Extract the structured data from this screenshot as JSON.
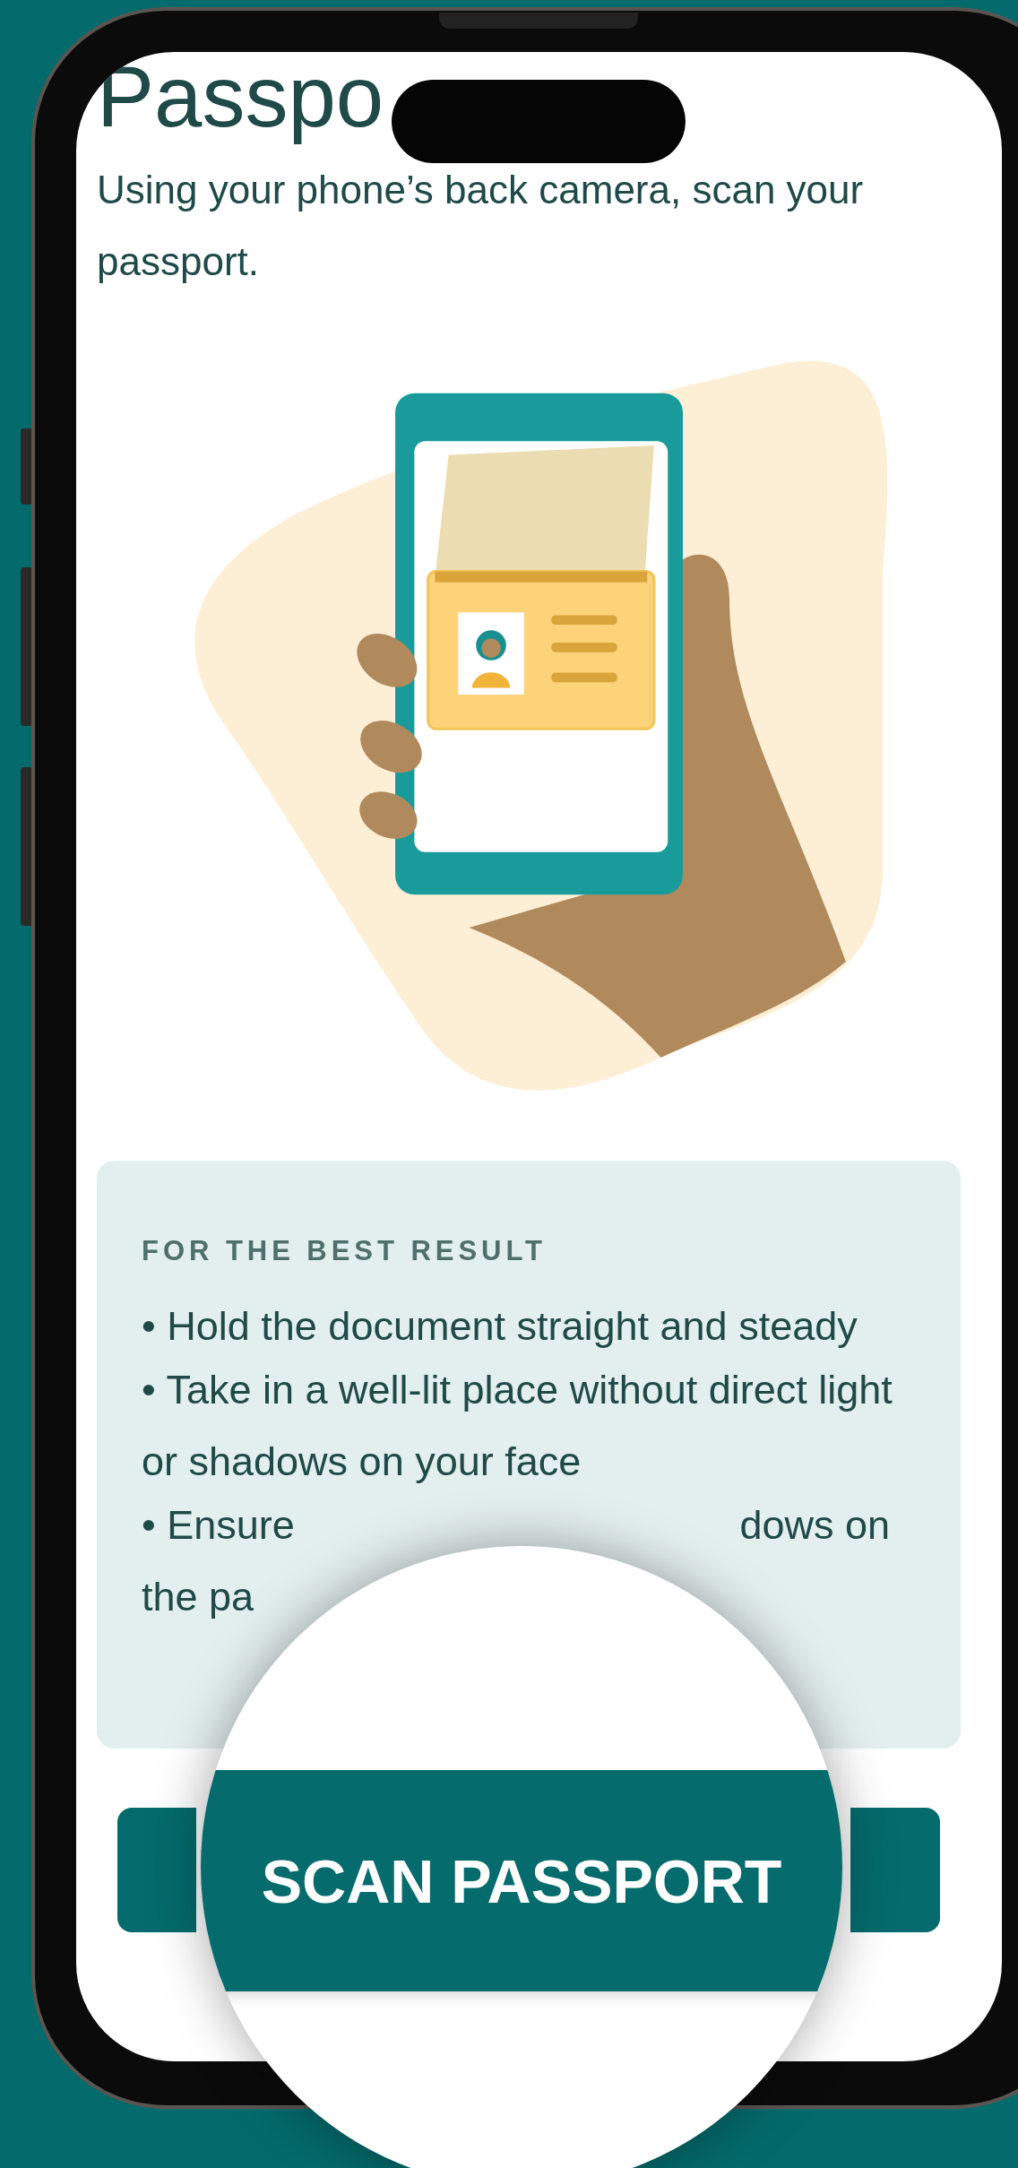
{
  "screen": {
    "title": "Passpo",
    "subtitle": "Using your phone’s back camera, scan your passport."
  },
  "tips": {
    "heading": "FOR THE BEST RESULT",
    "items": [
      {
        "kind": "full",
        "text": "• Hold the document straight and steady"
      },
      {
        "kind": "full",
        "text": "• Take in a well-lit place without direct light or shadows on your face"
      },
      {
        "kind": "covered",
        "start": "• Ensure",
        "end": "dows on",
        "next_line": "the pa"
      }
    ]
  },
  "magnifier": {
    "button_label": "SCAN PASSPORT"
  }
}
